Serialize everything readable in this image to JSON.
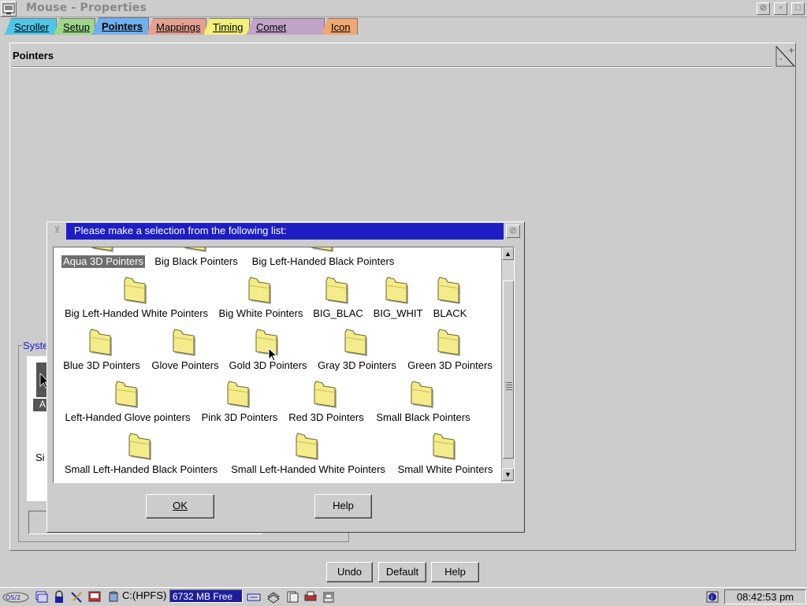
{
  "window": {
    "title": "Mouse - Properties"
  },
  "tabs": [
    {
      "label": "Scroller",
      "color": "#4ec6e8"
    },
    {
      "label": "Setup",
      "color": "#9fd68a"
    },
    {
      "label": "Pointers",
      "color": "#6fb0ee",
      "active": true
    },
    {
      "label": "Mappings",
      "color": "#e4a090"
    },
    {
      "label": "Timing",
      "color": "#f0f07a"
    },
    {
      "label": "Comet Cursor",
      "color": "#c0a4c8"
    },
    {
      "label": "Icon",
      "color": "#f0a870"
    }
  ],
  "page": {
    "title": "Pointers",
    "group_label": "Syste",
    "partial_selected": "A",
    "partial_size": "Si"
  },
  "dialog": {
    "title": "Please make a selection from the following list:",
    "items": [
      {
        "label": "Aqua 3D Pointers",
        "selected": true
      },
      {
        "label": "Big Black Pointers"
      },
      {
        "label": "Big Left-Handed Black Pointers"
      },
      {
        "label": "Big Left-Handed White Pointers"
      },
      {
        "label": "Big White Pointers"
      },
      {
        "label": "BIG_BLAC"
      },
      {
        "label": "BIG_WHIT"
      },
      {
        "label": "BLACK"
      },
      {
        "label": "Blue 3D Pointers"
      },
      {
        "label": "Glove Pointers"
      },
      {
        "label": "Gold 3D Pointers"
      },
      {
        "label": "Gray 3D Pointers"
      },
      {
        "label": "Green 3D Pointers"
      },
      {
        "label": "Left-Handed Glove pointers"
      },
      {
        "label": "Pink 3D Pointers"
      },
      {
        "label": "Red 3D Pointers"
      },
      {
        "label": "Small Black Pointers"
      },
      {
        "label": "Small Left-Handed Black Pointers"
      },
      {
        "label": "Small Left-Handed White Pointers"
      },
      {
        "label": "Small White Pointers"
      }
    ],
    "ok_label": "OK",
    "help_label": "Help"
  },
  "bottom_buttons": {
    "undo": "Undo",
    "default": "Default",
    "help": "Help"
  },
  "taskbar": {
    "drive": "C:(HPFS)",
    "free_space": "6732 MB Free",
    "clock": "08:42:53 pm"
  },
  "colors": {
    "dialog_title_bg": "#1e1ec6",
    "selection_bg": "#6e6e6e",
    "folder_fill": "#f4ec8a"
  }
}
